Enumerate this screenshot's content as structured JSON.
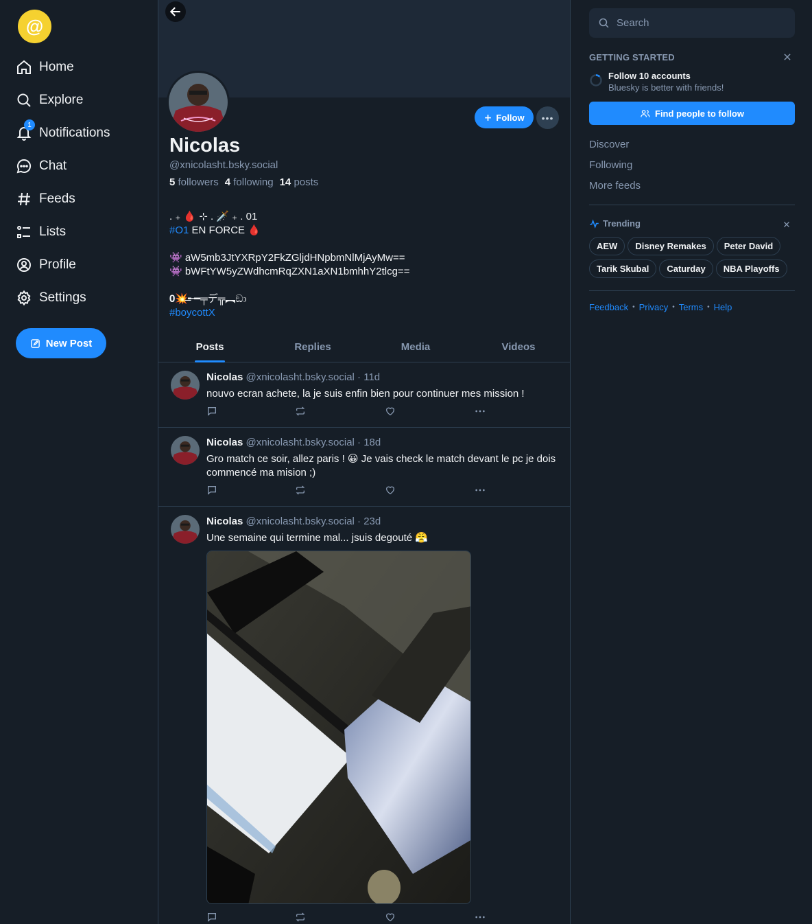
{
  "nav": {
    "items": [
      {
        "label": "Home",
        "icon": "home-icon"
      },
      {
        "label": "Explore",
        "icon": "search-icon"
      },
      {
        "label": "Notifications",
        "icon": "bell-icon"
      },
      {
        "label": "Chat",
        "icon": "chat-icon"
      },
      {
        "label": "Feeds",
        "icon": "hash-icon"
      },
      {
        "label": "Lists",
        "icon": "list-icon"
      },
      {
        "label": "Profile",
        "icon": "user-circle-icon"
      },
      {
        "label": "Settings",
        "icon": "gear-icon"
      }
    ],
    "notifications_badge": "1",
    "new_post_label": "New Post"
  },
  "profile": {
    "display_name": "Nicolas",
    "handle": "@xnicolasht.bsky.social",
    "followers_count": "5",
    "followers_label": "followers",
    "following_count": "4",
    "following_label": "following",
    "posts_count": "14",
    "posts_label": "posts",
    "follow_label": "Follow",
    "bio": {
      "line1": ". ₊ 🩸 ⊹ . 🗡️ ₊ . 01",
      "tag1": "#O1",
      "line2_rest": " EN FORCE 🩸",
      "line3": "👾  aW5mb3JtYXRpY2FkZGljdHNpbmNlMjAyMw==",
      "line4": "👾  bWFtYW5yZWdhcmRqZXN1aXN1bmhhY2tlcg==",
      "line5": "𝟎💥̶̶̶╾━╤デ╦︻ඞා",
      "tag2": "#boycottX"
    }
  },
  "tabs": [
    "Posts",
    "Replies",
    "Media",
    "Videos"
  ],
  "posts": [
    {
      "name": "Nicolas",
      "handle": "@xnicolasht.bsky.social",
      "age": "· 11d",
      "text": "nouvo ecran achete, la je suis enfin bien pour continuer mes mission !"
    },
    {
      "name": "Nicolas",
      "handle": "@xnicolasht.bsky.social",
      "age": "· 18d",
      "text": "Gro match ce soir, allez paris ! 😀 Je vais check le match devant le pc je dois commencé ma mision ;)"
    },
    {
      "name": "Nicolas",
      "handle": "@xnicolasht.bsky.social",
      "age": "· 23d",
      "text": "Une semaine qui termine mal... jsuis degouté 😤"
    }
  ],
  "right": {
    "search_placeholder": "Search",
    "getting_started": "GETTING STARTED",
    "gs_item_title": "Follow 10 accounts",
    "gs_item_sub": "Bluesky is better with friends!",
    "find_people_label": "Find people to follow",
    "feeds": [
      "Discover",
      "Following",
      "More feeds"
    ],
    "trending_title": "Trending",
    "trending": [
      "AEW",
      "Disney Remakes",
      "Peter David",
      "Tarik Skubal",
      "Caturday",
      "NBA Playoffs"
    ],
    "footer": [
      "Feedback",
      "Privacy",
      "Terms",
      "Help"
    ]
  },
  "colors": {
    "background": "#161e27",
    "accent": "#208bfe",
    "muted": "#8798b0",
    "logo": "#f5d130"
  }
}
